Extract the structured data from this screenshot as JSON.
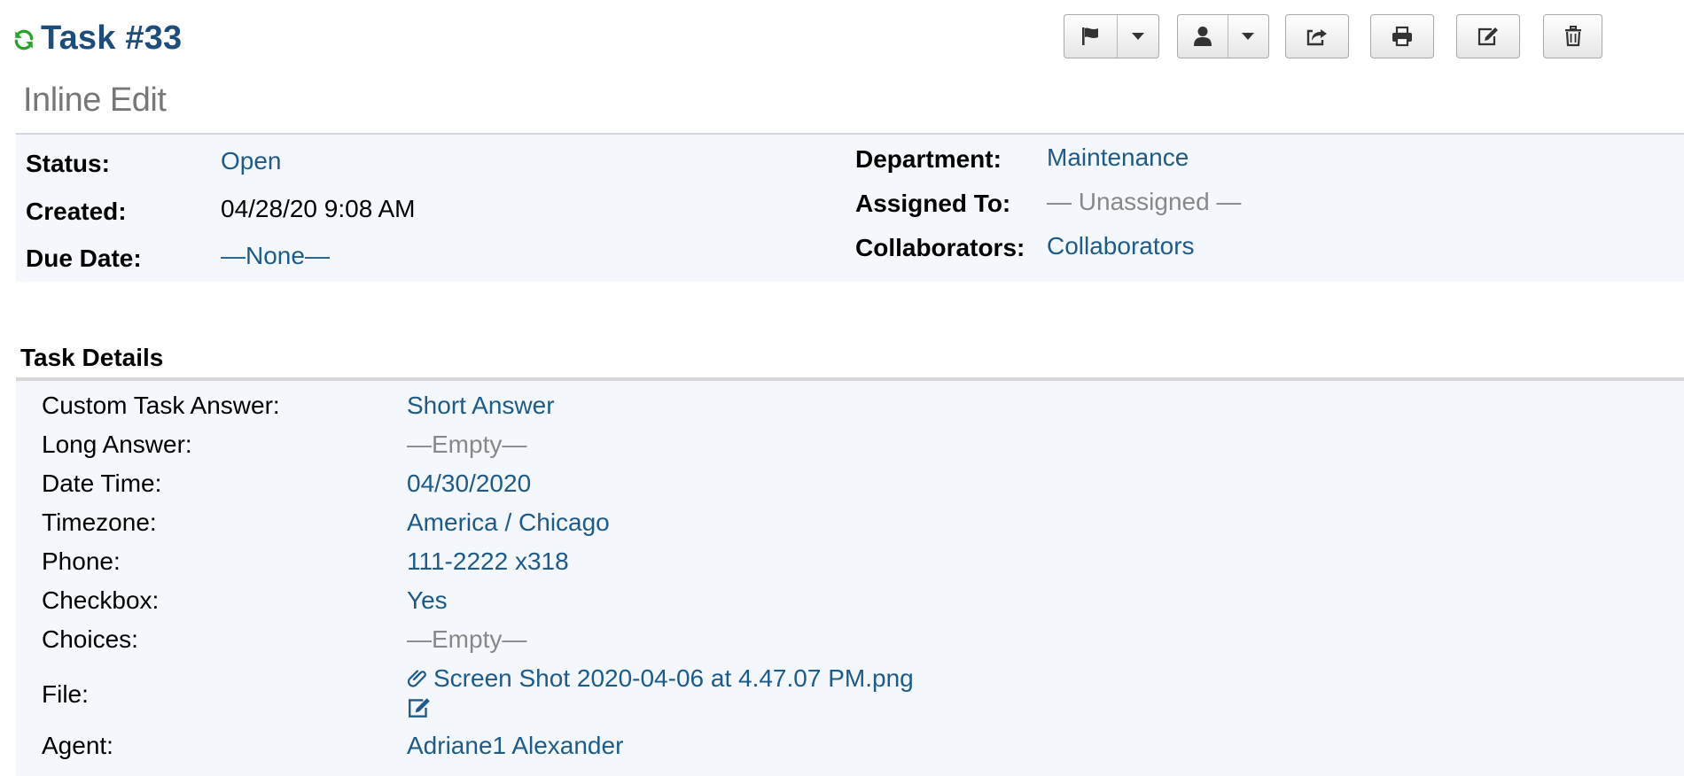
{
  "header": {
    "title": "Task #33",
    "subtitle": "Inline Edit"
  },
  "toolbar": {
    "buttons": [
      {
        "name": "flag",
        "icon": "flag-icon",
        "has_dropdown": true
      },
      {
        "name": "assign",
        "icon": "user-icon",
        "has_dropdown": true
      },
      {
        "name": "transfer",
        "icon": "share-icon"
      },
      {
        "name": "print",
        "icon": "print-icon"
      },
      {
        "name": "edit",
        "icon": "edit-icon"
      },
      {
        "name": "delete",
        "icon": "trash-icon"
      }
    ]
  },
  "info": {
    "status_label": "Status:",
    "status_value": "Open",
    "created_label": "Created:",
    "created_value": "04/28/20 9:08 AM",
    "due_label": "Due Date:",
    "due_value": "—None—",
    "department_label": "Department:",
    "department_value": "Maintenance",
    "assigned_label": "Assigned To:",
    "assigned_value": "— Unassigned —",
    "collaborators_label": "Collaborators:",
    "collaborators_value": "Collaborators"
  },
  "details": {
    "title": "Task Details",
    "fields": [
      {
        "label": "Custom Task Answer:",
        "value": "Short Answer"
      },
      {
        "label": "Long Answer:",
        "value": "—Empty—"
      },
      {
        "label": "Date Time:",
        "value": "04/30/2020"
      },
      {
        "label": "Timezone:",
        "value": "America / Chicago"
      },
      {
        "label": "Phone:",
        "value": "111-2222 x318"
      },
      {
        "label": "Checkbox:",
        "value": "Yes"
      },
      {
        "label": "Choices:",
        "value": "—Empty—"
      },
      {
        "label": "File:",
        "value": "Screen Shot 2020-04-06 at 4.47.07 PM.png"
      },
      {
        "label": "Agent:",
        "value": "Adriane1 Alexander"
      }
    ]
  },
  "colors": {
    "title": "#1e4d7b",
    "link": "#1e5a8a",
    "muted": "#888888",
    "refresh_icon": "#27a327",
    "panel_bg": "#f4f8fc"
  }
}
